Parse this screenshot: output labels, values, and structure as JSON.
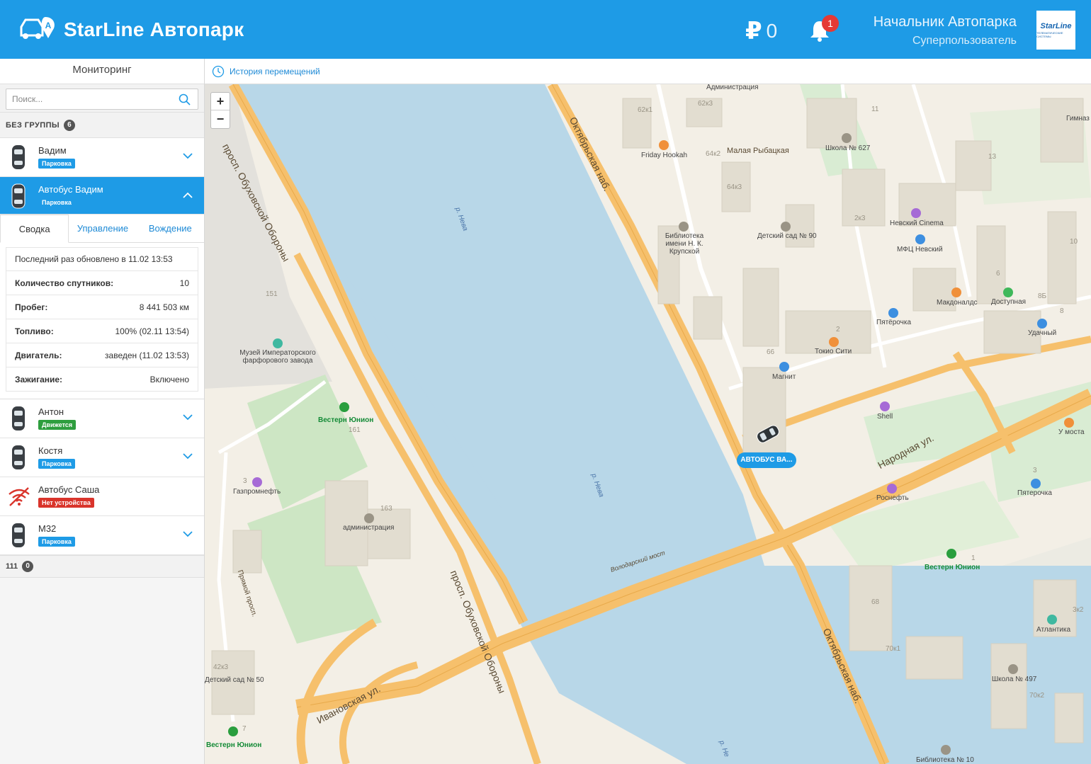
{
  "header": {
    "app_title": "StarLine Автопарк",
    "currency_symbol": "₽",
    "balance": "0",
    "notifications_count": "1",
    "user_name": "Начальник Автопарка",
    "user_role": "Суперпользователь",
    "logo_brand": "StarLine",
    "logo_caption": "ТЕЛЕМАТИЧЕСКИЕ СИСТЕМЫ",
    "color": "#1e9be6"
  },
  "sidebar": {
    "title": "Мониторинг",
    "search_placeholder": "Поиск...",
    "group1": {
      "label": "БЕЗ ГРУППЫ",
      "count": "6"
    },
    "vehicles": [
      {
        "name": "Вадим",
        "status": "Парковка"
      },
      {
        "name": "Автобус Вадим",
        "status": "Парковка"
      },
      {
        "name": "Антон",
        "status": "Движется"
      },
      {
        "name": "Костя",
        "status": "Парковка"
      },
      {
        "name": "Автобус Саша",
        "status": "Нет устройства"
      },
      {
        "name": "М32",
        "status": "Парковка"
      }
    ],
    "tabs": [
      "Сводка",
      "Управление",
      "Вождение"
    ],
    "details": {
      "updated": "Последний раз обновлено в 11.02 13:53",
      "rows": [
        {
          "k": "Количество спутников:",
          "v": "10"
        },
        {
          "k": "Пробег:",
          "v": "8 441 503 км"
        },
        {
          "k": "Топливо:",
          "v": "100% (02.11 13:54)"
        },
        {
          "k": "Двигатель:",
          "v": "заведен (11.02 13:53)"
        },
        {
          "k": "Зажигание:",
          "v": "Включено"
        }
      ]
    },
    "group2": {
      "label": "111",
      "count": "0"
    }
  },
  "toolbar": {
    "history_label": "История перемещений"
  },
  "map": {
    "zoom_in": "+",
    "zoom_out": "−",
    "vehicle_marker": "АВТОБУС ВА...",
    "streets": [
      "просп. Обуховской Обороны",
      "Октябрьская наб.",
      "Народная ул.",
      "Ивановская ул.",
      "Прямой просп.",
      "Малая Рыбацкая",
      "Володарский мост"
    ],
    "water": [
      "р. Нева",
      "р. Нева",
      "р. Не"
    ],
    "places": [
      "Friday Hookah",
      "Школа № 627",
      "Библиотека имени Н. К. Крупской",
      "Детский сад № 90",
      "Невский Cinema",
      "МФЦ Невский",
      "Макдоналдс",
      "Доступная",
      "Пятёрочка",
      "Удачный",
      "Токио Сити",
      "Магнит",
      "Shell",
      "У моста",
      "Роснефть",
      "Пятерочка",
      "Музей Императорского фарфорового завода",
      "Вестерн Юнион",
      "Газпромнефть",
      "администрация",
      "Атлантика",
      "Школа № 497",
      "Детский сад № 50",
      "Библиотека № 10",
      "Гимназ",
      "Администрация"
    ],
    "house_numbers": [
      "62к1",
      "62к3",
      "64к2",
      "64к3",
      "11",
      "13",
      "2к3",
      "10",
      "6",
      "8Б",
      "8",
      "2",
      "66",
      "151",
      "161",
      "163",
      "3",
      "68",
      "70к1",
      "70к2",
      "3к2",
      "42к3",
      "7",
      "1",
      "3"
    ],
    "colors": {
      "water": "#b8d7e8",
      "land": "#f3efe6",
      "road": "#f6c06c",
      "park": "#cde6c4"
    }
  }
}
